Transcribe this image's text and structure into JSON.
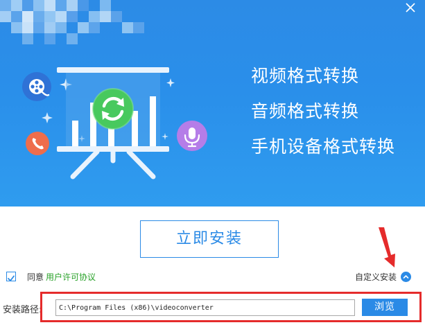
{
  "banner": {
    "features": [
      {
        "label": "视频格式转换"
      },
      {
        "label": "音频格式转换"
      },
      {
        "label": "手机设备格式转换"
      }
    ],
    "icons": {
      "film": "film-reel-icon",
      "phone": "phone-icon",
      "mic": "microphone-icon",
      "refresh": "refresh-icon"
    },
    "colors": {
      "background": "#2c8be6",
      "film_icon": "#2f72d6",
      "phone_icon": "#ee6d4c",
      "mic_icon": "#b57de8",
      "refresh_icon": "#48c95e"
    }
  },
  "install": {
    "label": "立即安装"
  },
  "agreement": {
    "checked": true,
    "agree_text": "同意",
    "license_link": "用户许可协议"
  },
  "custom_install": {
    "label": "自定义安装"
  },
  "path": {
    "label": "安装路径:",
    "value": "C:\\Program Files (x86)\\videoconverter",
    "browse_label": "浏览"
  },
  "colors": {
    "accent": "#2a8ae6",
    "link": "#27a127",
    "annotation": "#e52b2b"
  }
}
